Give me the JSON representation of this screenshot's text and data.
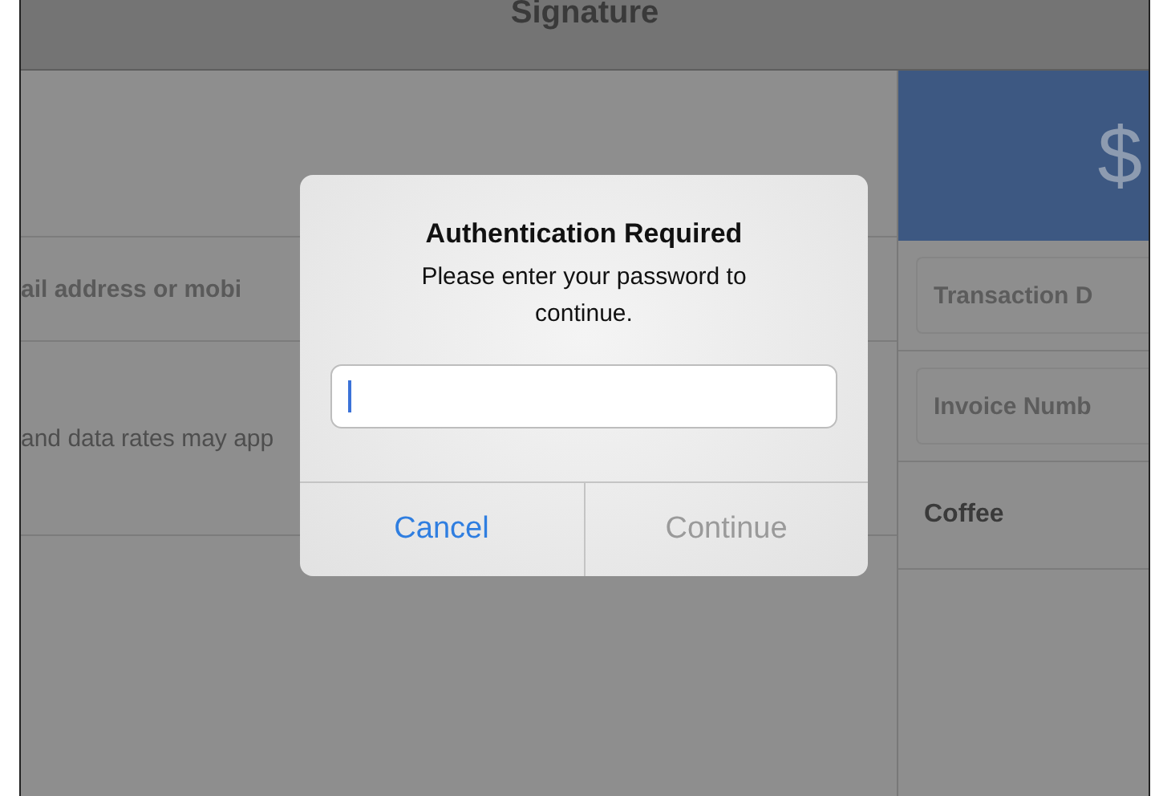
{
  "title_bar": {
    "title": "Signature"
  },
  "left_panel": {
    "rows": [
      {
        "kind": "blank"
      },
      {
        "kind": "field",
        "text": "ail address or mobi"
      },
      {
        "kind": "note",
        "text": "and data rates may app"
      }
    ]
  },
  "right_panel": {
    "amount": "$",
    "fields": [
      {
        "placeholder": "Transaction D"
      },
      {
        "placeholder": "Invoice Numb"
      }
    ],
    "items": [
      {
        "name": "Coffee"
      }
    ]
  },
  "dialog": {
    "title": "Authentication Required",
    "message": "Please enter your password to continue.",
    "password_field": {
      "focused": true
    },
    "buttons": [
      {
        "label": "Cancel",
        "disabled": false
      },
      {
        "label": "Continue",
        "disabled": true
      }
    ]
  }
}
